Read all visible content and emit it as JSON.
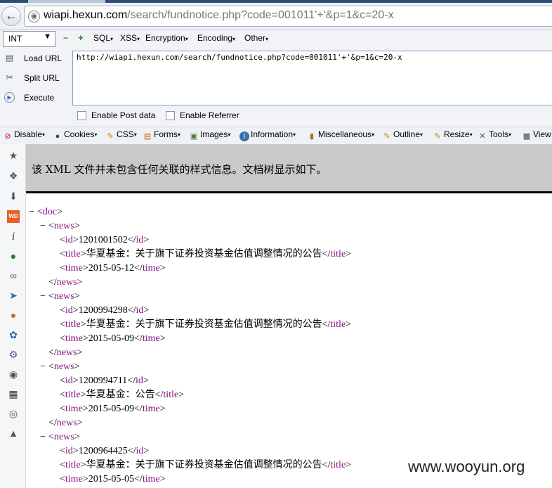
{
  "browser": {
    "address_host": "wiapi.hexun.com",
    "address_path": "/search/fundnotice.php?code=001011'+'&p=1&c=20-x"
  },
  "hackbar": {
    "select_value": "INT",
    "menus": [
      "SQL",
      "XSS",
      "Encryption",
      "Encoding",
      "Other"
    ],
    "load_label": "Load URL",
    "split_label": "Split URL",
    "execute_label": "Execute",
    "url_value": "http://wiapi.hexun.com/search/fundnotice.php?code=001011'+'&p=1&c=20-x",
    "post_label": "Enable Post data",
    "referrer_label": "Enable Referrer"
  },
  "webdev": {
    "items": [
      "Disable",
      "Cookies",
      "CSS",
      "Forms",
      "Images",
      "Information",
      "Miscellaneous",
      "Outline",
      "Resize",
      "Tools",
      "View"
    ]
  },
  "colors": {
    "tag": "#881280",
    "banner": "#c9c9c9"
  },
  "content": {
    "notice": "该 XML 文件并未包含任何关联的样式信息。文档树显示如下。",
    "root_tag": "doc",
    "news": [
      {
        "id": "1201001502",
        "title": "华夏基金：关于旗下证券投资基金估值调整情况的公告",
        "time": "2015-05-12"
      },
      {
        "id": "1200994298",
        "title": "华夏基金：关于旗下证券投资基金估值调整情况的公告",
        "time": "2015-05-09"
      },
      {
        "id": "1200994711",
        "title": "华夏基金：公告",
        "time": "2015-05-09"
      },
      {
        "id": "1200964425",
        "title": "华夏基金：关于旗下证券投资基金估值调整情况的公告",
        "time": "2015-05-05"
      }
    ]
  },
  "watermark": "www.wooyun.org"
}
